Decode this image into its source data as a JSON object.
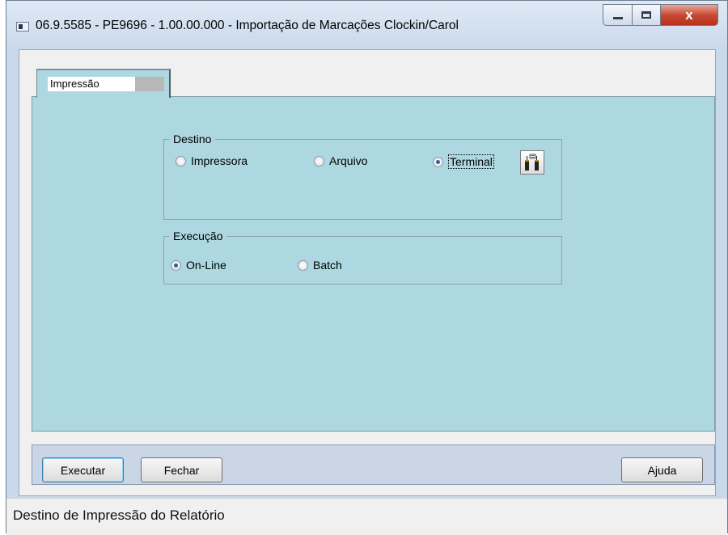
{
  "window": {
    "title": "06.9.5585 - PE9696 - 1.00.00.000 - Importação de Marcações Clockin/Carol",
    "close_glyph": "x"
  },
  "tabs": [
    {
      "label": "Impressão",
      "selected": true
    }
  ],
  "destino": {
    "legend": "Destino",
    "options": [
      {
        "label": "Impressora",
        "selected": false
      },
      {
        "label": "Arquivo",
        "selected": false
      },
      {
        "label": "Terminal",
        "selected": true
      }
    ],
    "config_icon": "printer-setup-icon"
  },
  "execucao": {
    "legend": "Execução",
    "options": [
      {
        "label": "On-Line",
        "selected": true
      },
      {
        "label": "Batch",
        "selected": false
      }
    ]
  },
  "buttons": {
    "executar": "Executar",
    "fechar": "Fechar",
    "ajuda": "Ajuda"
  },
  "status": {
    "text": "Destino de Impressão do Relatório"
  },
  "colors": {
    "panel": "#add8e2",
    "button_bar": "#cad5e6",
    "close_button": "#c74a34",
    "radio_selected": "#2b5fb0"
  }
}
